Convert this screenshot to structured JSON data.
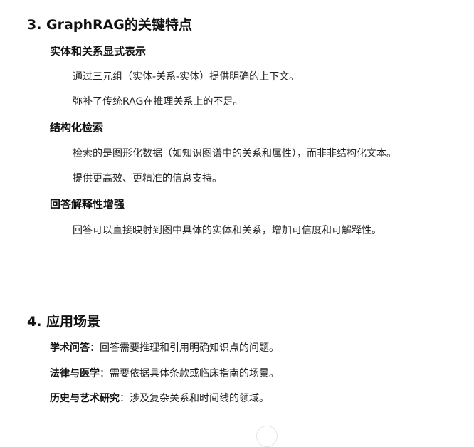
{
  "section3": {
    "heading": "3. GraphRAG的关键特点",
    "features": [
      {
        "title": "实体和关系显式表示",
        "points": [
          "通过三元组（实体-关系-实体）提供明确的上下文。",
          "弥补了传统RAG在推理关系上的不足。"
        ]
      },
      {
        "title": "结构化检索",
        "points": [
          "检索的是图形化数据（如知识图谱中的关系和属性），而非非结构化文本。",
          "提供更高效、更精准的信息支持。"
        ]
      },
      {
        "title": "回答解释性增强",
        "points": [
          "回答可以直接映射到图中具体的实体和关系，增加可信度和可解释性。"
        ]
      }
    ]
  },
  "section4": {
    "heading": "4. 应用场景",
    "items": [
      {
        "term": "学术问答",
        "desc": "：回答需要推理和引用明确知识点的问题。"
      },
      {
        "term": "法律与医学",
        "desc": "：需要依据具体条款或临床指南的场景。"
      },
      {
        "term": "历史与艺术研究",
        "desc": "：涉及复杂关系和时间线的领域。"
      }
    ]
  }
}
